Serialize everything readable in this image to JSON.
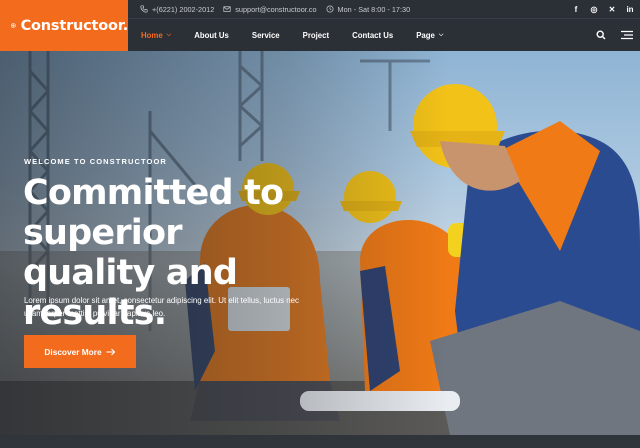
{
  "brand": {
    "name": "Constructoor.",
    "accent": "#f36b1c",
    "dark": "#2b2f36"
  },
  "topbar": {
    "phone": {
      "icon": "phone-icon",
      "text": "+(6221) 2002-2012"
    },
    "email": {
      "icon": "envelope-icon",
      "text": "support@constructoor.co"
    },
    "hours": {
      "icon": "clock-icon",
      "text": "Mon - Sat 8:00 - 17:30"
    },
    "socials": [
      {
        "icon": "facebook-icon",
        "glyph": "f"
      },
      {
        "icon": "instagram-icon",
        "glyph": "◎"
      },
      {
        "icon": "twitter-icon",
        "glyph": "✕"
      },
      {
        "icon": "linkedin-icon",
        "glyph": "in"
      }
    ]
  },
  "nav": {
    "items": [
      {
        "label": "Home",
        "active": true,
        "dropdown": true
      },
      {
        "label": "About Us",
        "active": false,
        "dropdown": false
      },
      {
        "label": "Service",
        "active": false,
        "dropdown": false
      },
      {
        "label": "Project",
        "active": false,
        "dropdown": false
      },
      {
        "label": "Contact Us",
        "active": false,
        "dropdown": false
      },
      {
        "label": "Page",
        "active": false,
        "dropdown": true
      }
    ],
    "search_icon": "search-icon",
    "menu_icon": "hamburger-icon"
  },
  "hero": {
    "eyebrow": "WELCOME TO CONSTRUCTOOR",
    "headline": "Committed to superior quality and results.",
    "subtext": "Lorem ipsum dolor sit amet, consectetur adipiscing elit. Ut elit tellus, luctus nec ullamcorper mattis, pulvinar dapibus leo.",
    "cta_label": "Discover More",
    "cta_icon": "arrow-right-icon"
  }
}
